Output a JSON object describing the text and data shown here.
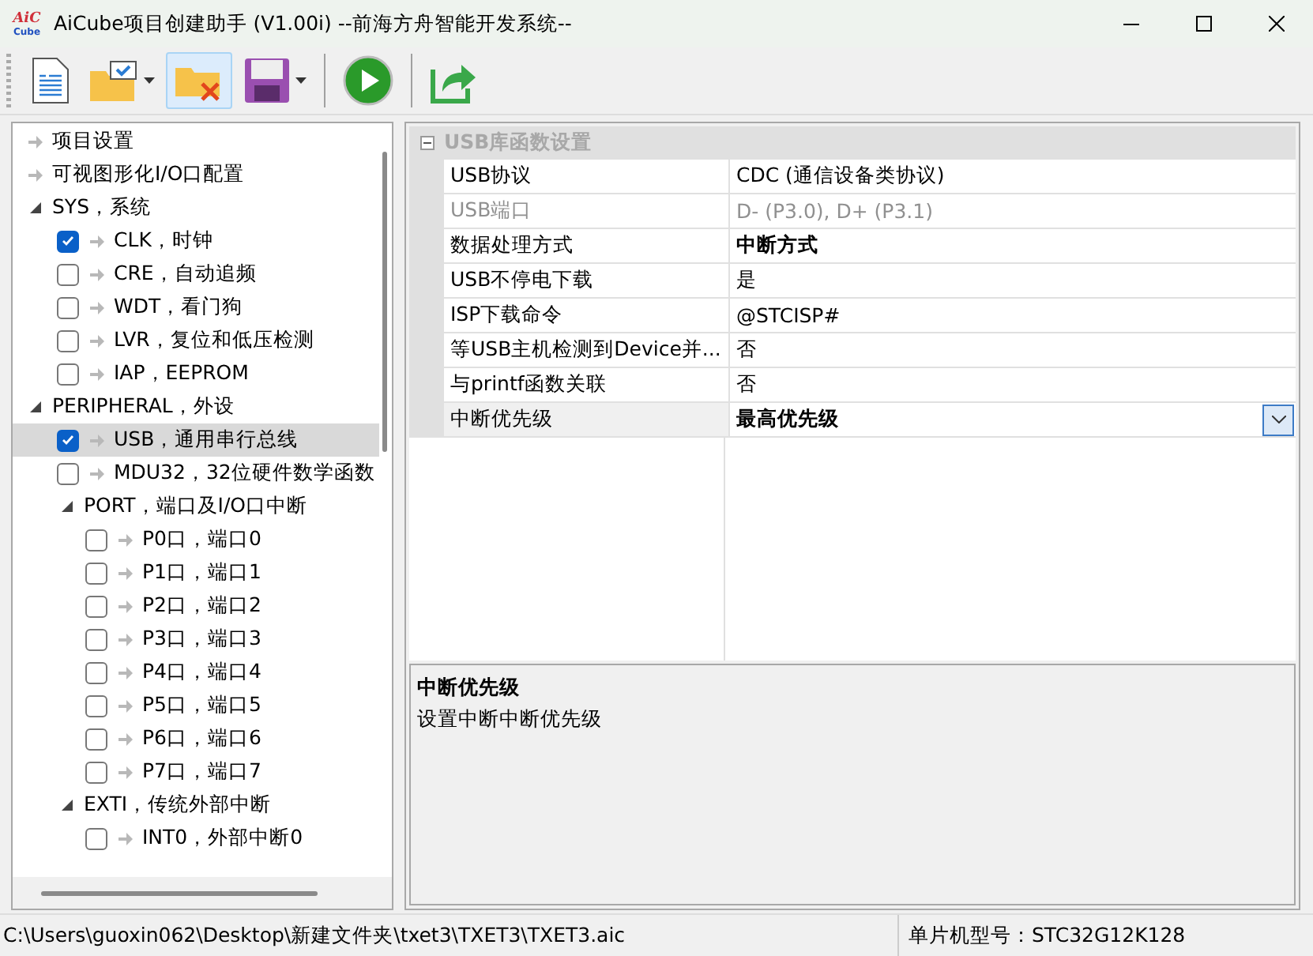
{
  "window": {
    "logo_top": "AiC",
    "logo_bottom": "Cube",
    "title": "AiCube项目创建助手 (V1.00i) --前海方舟智能开发系统--"
  },
  "toolbar": [
    {
      "kind": "new",
      "dropdown": false,
      "pressed": false
    },
    {
      "kind": "open",
      "dropdown": true,
      "pressed": false
    },
    {
      "kind": "close",
      "dropdown": false,
      "pressed": true
    },
    {
      "kind": "save",
      "dropdown": true,
      "pressed": false
    },
    {
      "kind": "separator"
    },
    {
      "kind": "run",
      "dropdown": false,
      "pressed": false
    },
    {
      "kind": "separator"
    },
    {
      "kind": "export",
      "dropdown": false,
      "pressed": false
    }
  ],
  "tree": [
    {
      "label": "项目设置",
      "kind": "leaf",
      "selected": false
    },
    {
      "label": "可视图形化I/O口配置",
      "kind": "leaf",
      "selected": false
    },
    {
      "label": "SYS，系统",
      "kind": "group",
      "expanded": true,
      "selected": false,
      "children": [
        {
          "label": "CLK，时钟",
          "kind": "leaf",
          "checked": true,
          "selected": false
        },
        {
          "label": "CRE，自动追频",
          "kind": "leaf",
          "checked": false,
          "selected": false
        },
        {
          "label": "WDT，看门狗",
          "kind": "leaf",
          "checked": false,
          "selected": false
        },
        {
          "label": "LVR，复位和低压检测",
          "kind": "leaf",
          "checked": false,
          "selected": false
        },
        {
          "label": "IAP，EEPROM",
          "kind": "leaf",
          "checked": false,
          "selected": false
        }
      ]
    },
    {
      "label": "PERIPHERAL，外设",
      "kind": "group",
      "expanded": true,
      "selected": false,
      "children": [
        {
          "label": "USB，通用串行总线",
          "kind": "leaf",
          "checked": true,
          "selected": true
        },
        {
          "label": "MDU32，32位硬件数学函数",
          "kind": "leaf",
          "checked": false,
          "selected": false
        },
        {
          "label": "PORT，端口及I/O口中断",
          "kind": "group",
          "expanded": true,
          "selected": false,
          "children": [
            {
              "label": "P0口，端口0",
              "kind": "leaf",
              "checked": false,
              "selected": false
            },
            {
              "label": "P1口，端口1",
              "kind": "leaf",
              "checked": false,
              "selected": false
            },
            {
              "label": "P2口，端口2",
              "kind": "leaf",
              "checked": false,
              "selected": false
            },
            {
              "label": "P3口，端口3",
              "kind": "leaf",
              "checked": false,
              "selected": false
            },
            {
              "label": "P4口，端口4",
              "kind": "leaf",
              "checked": false,
              "selected": false
            },
            {
              "label": "P5口，端口5",
              "kind": "leaf",
              "checked": false,
              "selected": false
            },
            {
              "label": "P6口，端口6",
              "kind": "leaf",
              "checked": false,
              "selected": false
            },
            {
              "label": "P7口，端口7",
              "kind": "leaf",
              "checked": false,
              "selected": false
            }
          ]
        },
        {
          "label": "EXTI，传统外部中断",
          "kind": "group",
          "expanded": true,
          "selected": false,
          "children": [
            {
              "label": "INT0，外部中断0",
              "kind": "leaf",
              "checked": false,
              "selected": false
            }
          ]
        }
      ]
    }
  ],
  "properties": {
    "category": "USB库函数设置",
    "expanded": true,
    "rows": [
      {
        "name": "USB协议",
        "value": "CDC (通信设备类协议)",
        "disabled": false,
        "bold": false,
        "selected": false,
        "dropdown": false
      },
      {
        "name": "USB端口",
        "value": "D- (P3.0), D+ (P3.1)",
        "disabled": true,
        "bold": false,
        "selected": false,
        "dropdown": false
      },
      {
        "name": "数据处理方式",
        "value": "中断方式",
        "disabled": false,
        "bold": true,
        "selected": false,
        "dropdown": false
      },
      {
        "name": "USB不停电下载",
        "value": "是",
        "disabled": false,
        "bold": false,
        "selected": false,
        "dropdown": false
      },
      {
        "name": "ISP下载命令",
        "value": "@STCISP#",
        "disabled": false,
        "bold": false,
        "selected": false,
        "dropdown": false
      },
      {
        "name": "等USB主机检测到Device并...",
        "value": "否",
        "disabled": false,
        "bold": false,
        "selected": false,
        "dropdown": false
      },
      {
        "name": "与printf函数关联",
        "value": "否",
        "disabled": false,
        "bold": false,
        "selected": false,
        "dropdown": false
      },
      {
        "name": "中断优先级",
        "value": "最高优先级",
        "disabled": false,
        "bold": true,
        "selected": true,
        "dropdown": true
      }
    ]
  },
  "description": {
    "title": "中断优先级",
    "text": "设置中断中断优先级"
  },
  "status_bar": {
    "path": "C:\\Users\\guoxin062\\Desktop\\新建文件夹\\txet3\\TXET3\\TXET3.aic",
    "chip": "单片机型号：STC32G12K128"
  }
}
